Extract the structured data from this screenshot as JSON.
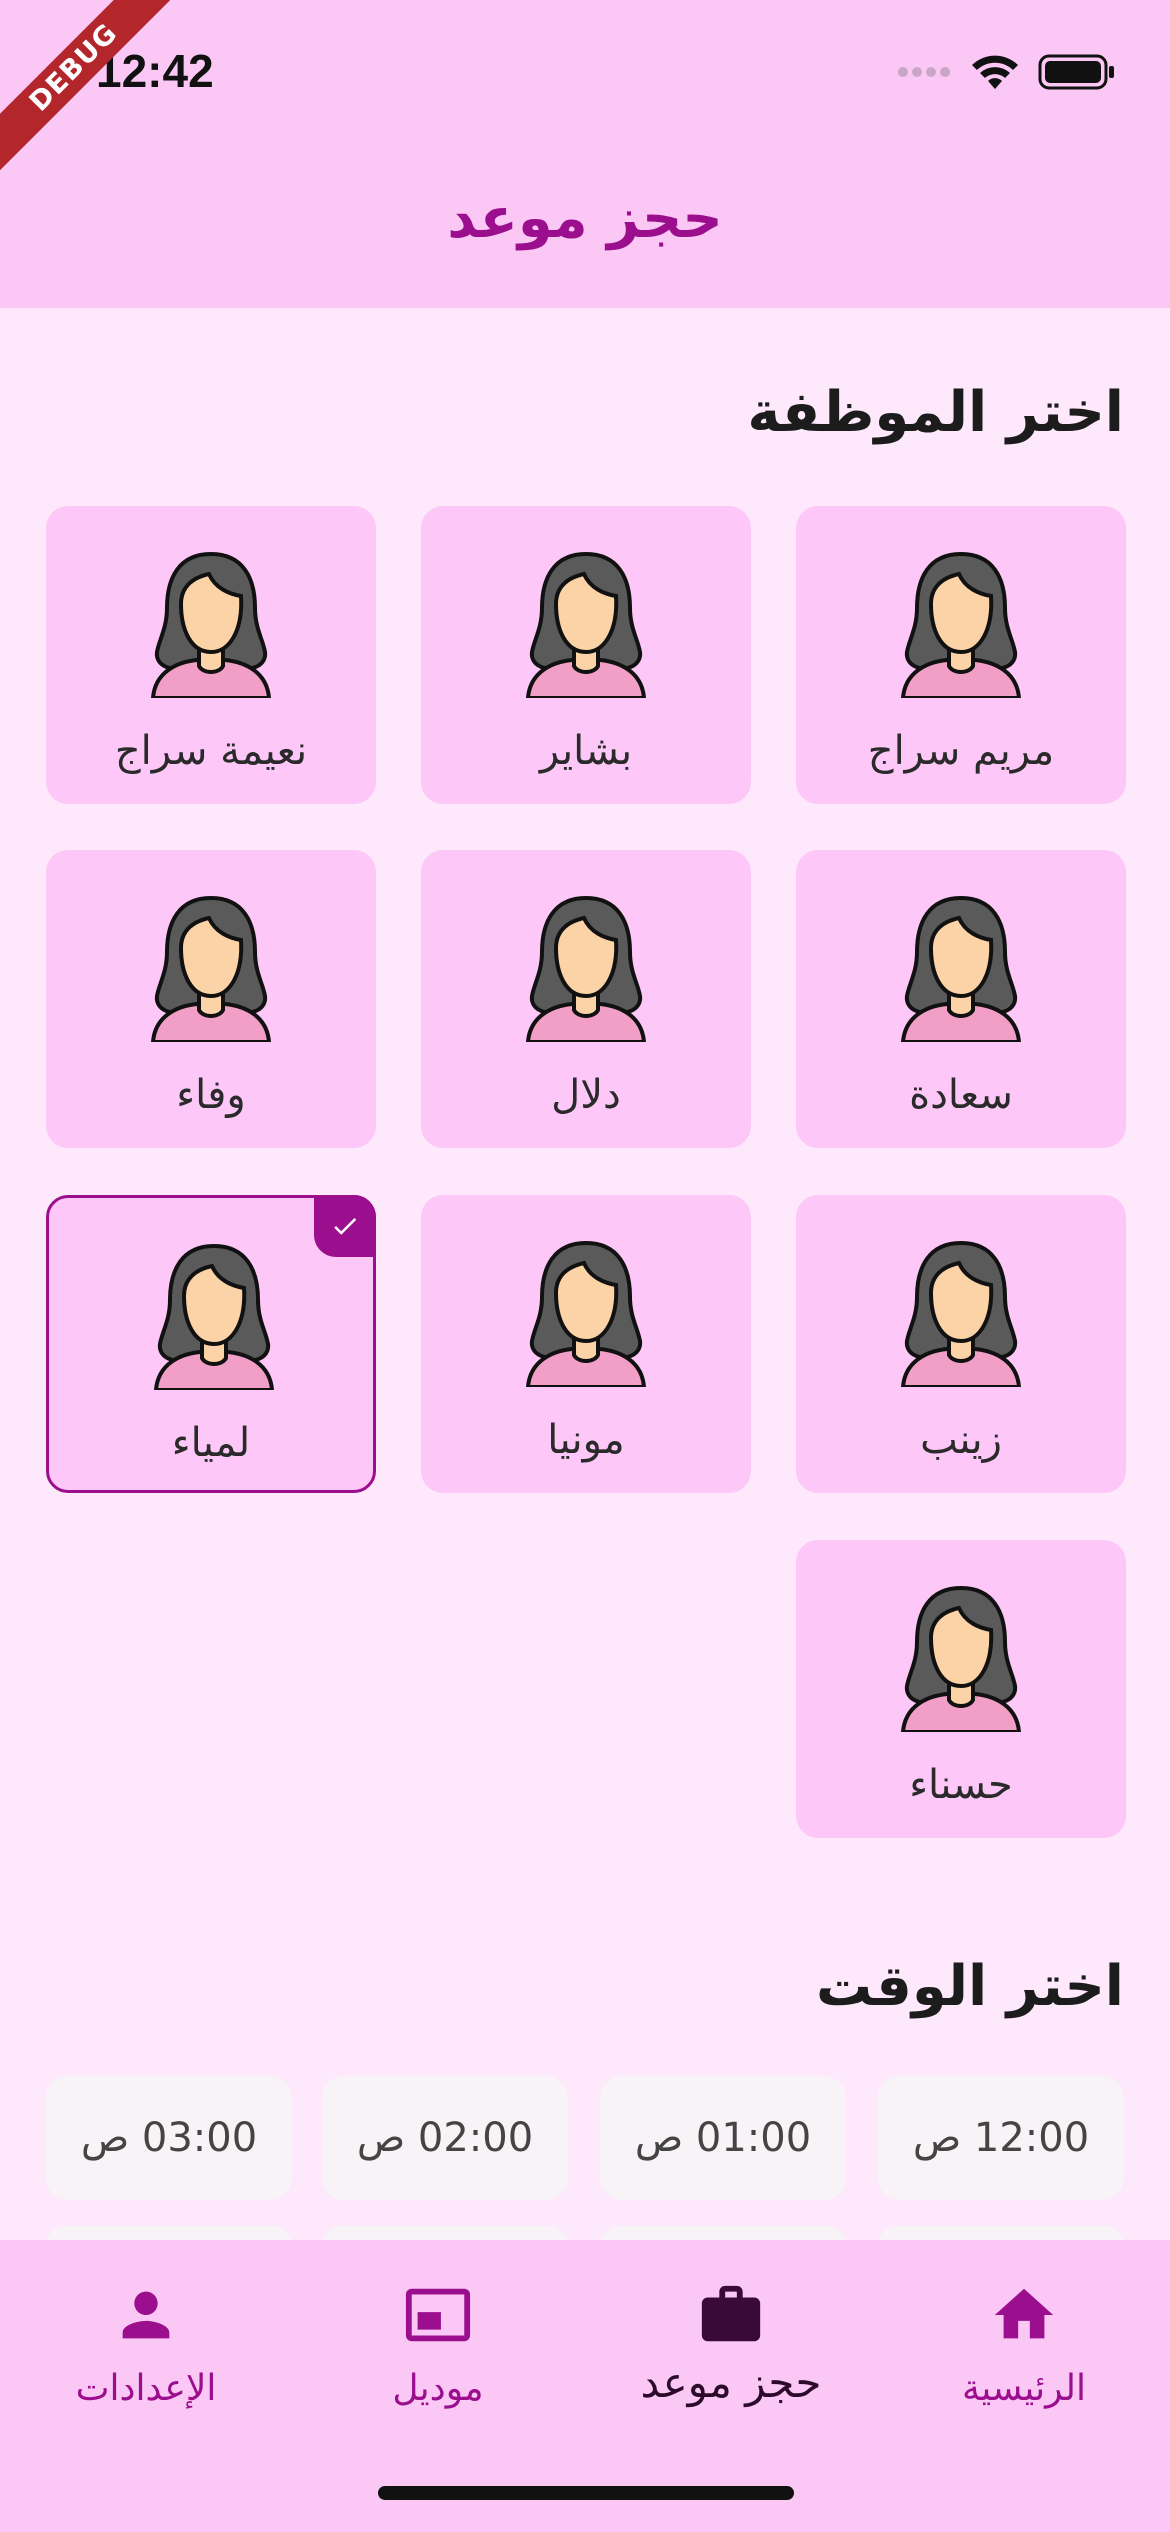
{
  "status_bar": {
    "time": "12:42",
    "debug_label": "DEBUG"
  },
  "app_bar": {
    "title": "حجز موعد"
  },
  "sections": {
    "employees_title": "اختر الموظفة",
    "time_title": "اختر الوقت"
  },
  "employees": [
    {
      "name": "مريم سراج",
      "selected": false
    },
    {
      "name": "بشاير",
      "selected": false
    },
    {
      "name": "نعيمة سراج",
      "selected": false
    },
    {
      "name": "سعادة",
      "selected": false
    },
    {
      "name": "دلال",
      "selected": false
    },
    {
      "name": "وفاء",
      "selected": false
    },
    {
      "name": "زينب",
      "selected": false
    },
    {
      "name": "مونيا",
      "selected": false
    },
    {
      "name": "لمياء",
      "selected": true
    },
    {
      "name": "حسناء",
      "selected": false
    }
  ],
  "time_slots": [
    "12:00 ص",
    "01:00 ص",
    "02:00 ص",
    "03:00 ص"
  ],
  "bottom_nav": {
    "items": [
      {
        "label": "الرئيسية",
        "icon": "home-icon",
        "active": false
      },
      {
        "label": "حجز موعد",
        "icon": "briefcase-icon",
        "active": true
      },
      {
        "label": "موديل",
        "icon": "picture-in-picture-icon",
        "active": false
      },
      {
        "label": "الإعدادات",
        "icon": "person-icon",
        "active": false
      }
    ]
  },
  "colors": {
    "accent": "#9b0f8f",
    "app_bar_bg": "#fbc8f6",
    "page_bg": "#fde9fb",
    "card_bg": "#fdc8f8",
    "chip_bg": "#f7f3f6"
  }
}
